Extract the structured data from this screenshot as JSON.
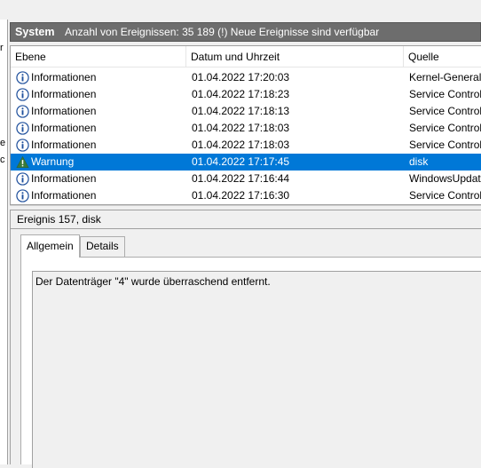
{
  "left_strip": {
    "fragments": [
      "r",
      "e",
      "c"
    ]
  },
  "panel": {
    "title": "System",
    "event_count": "Anzahl von Ereignissen: 35 189 (!) Neue Ereignisse sind verfügbar"
  },
  "list": {
    "columns": [
      "Ebene",
      "Datum und Uhrzeit",
      "Quelle"
    ],
    "rows": [
      {
        "level": "Informationen",
        "icon": "info-icon",
        "datetime": "01.04.2022 17:20:03",
        "source": "Kernel-General"
      },
      {
        "level": "Informationen",
        "icon": "info-icon",
        "datetime": "01.04.2022 17:18:23",
        "source": "Service Control"
      },
      {
        "level": "Informationen",
        "icon": "info-icon",
        "datetime": "01.04.2022 17:18:13",
        "source": "Service Control"
      },
      {
        "level": "Informationen",
        "icon": "info-icon",
        "datetime": "01.04.2022 17:18:03",
        "source": "Service Control"
      },
      {
        "level": "Informationen",
        "icon": "info-icon",
        "datetime": "01.04.2022 17:18:03",
        "source": "Service Control"
      },
      {
        "level": "Warnung",
        "icon": "warning-icon",
        "datetime": "01.04.2022 17:17:45",
        "source": "disk",
        "selected": true
      },
      {
        "level": "Informationen",
        "icon": "info-icon",
        "datetime": "01.04.2022 17:16:44",
        "source": "WindowsUpdat"
      },
      {
        "level": "Informationen",
        "icon": "info-icon",
        "datetime": "01.04.2022 17:16:30",
        "source": "Service Control"
      }
    ]
  },
  "detail": {
    "title": "Ereignis 157, disk",
    "tabs": [
      "Allgemein",
      "Details"
    ],
    "active_tab": "Allgemein",
    "message": "Der Datenträger \"4\" wurde überraschend entfernt."
  },
  "colors": {
    "header_bg": "#6d6d6d",
    "selection": "#0078d7",
    "info_icon": "#1e4f9c",
    "warning_icon": "#3a7a3a"
  }
}
